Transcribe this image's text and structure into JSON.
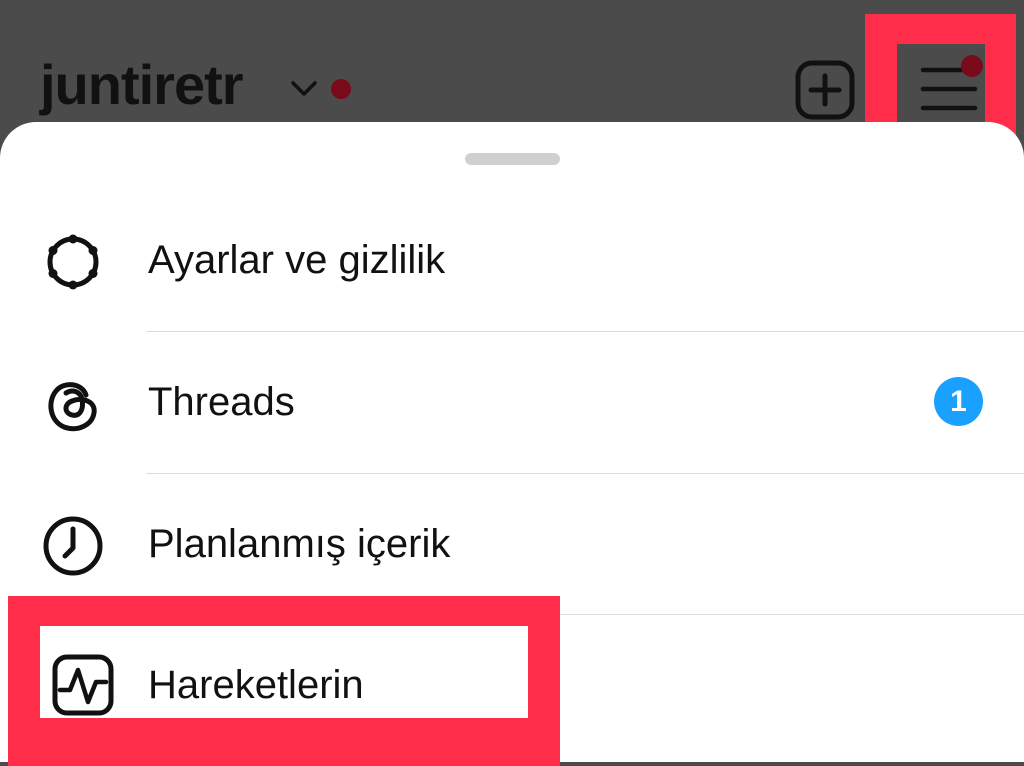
{
  "header": {
    "username": "juntiretr",
    "icons": [
      "chevron-down-icon",
      "notification-dot",
      "new-post-icon",
      "hamburger-menu-icon"
    ]
  },
  "menu": {
    "items": [
      {
        "label": "Ayarlar ve gizlilik",
        "icon": "settings-gear-icon"
      },
      {
        "label": "Threads",
        "icon": "threads-icon",
        "badge": "1"
      },
      {
        "label": "Planlanmış içerik",
        "icon": "clock-icon"
      },
      {
        "label": "Hareketlerin",
        "icon": "activity-icon"
      }
    ]
  },
  "colors": {
    "highlight": "#ff2d49",
    "badge": "#1aa1ff",
    "overlay": "#4b4b4b",
    "notification_dot": "#7a0a1a"
  }
}
